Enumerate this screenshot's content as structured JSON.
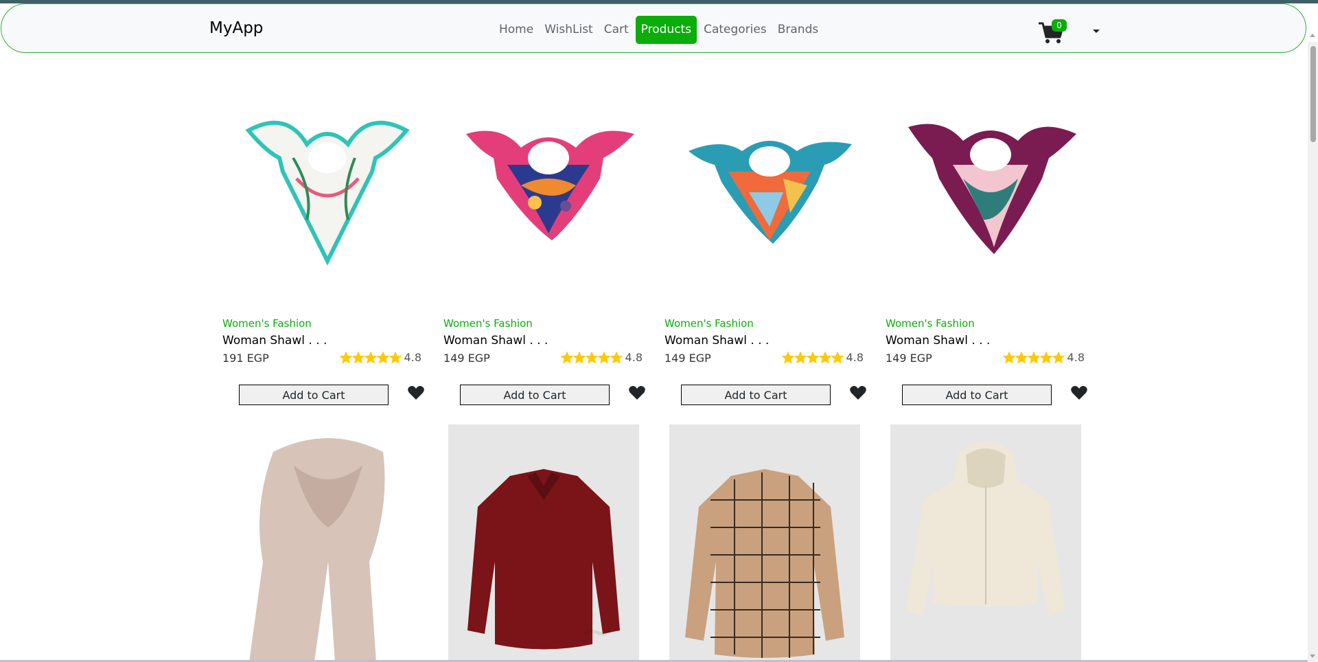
{
  "nav": {
    "brand": "MyApp",
    "links": [
      "Home",
      "WishList",
      "Cart",
      "Products",
      "Categories",
      "Brands"
    ],
    "active": "Products",
    "cart_count": "0",
    "accent": "#0aad0a"
  },
  "products": [
    {
      "category": "Women's Fashion",
      "title": "Woman Shawl . . .",
      "price": "191 EGP",
      "rating": "4.8",
      "rating_value": 4.8,
      "button": "Add to Cart",
      "image": "scarf-white-floral"
    },
    {
      "category": "Women's Fashion",
      "title": "Woman Shawl . . .",
      "price": "149 EGP",
      "rating": "4.8",
      "rating_value": 4.8,
      "button": "Add to Cart",
      "image": "scarf-pink-blue"
    },
    {
      "category": "Women's Fashion",
      "title": "Woman Shawl . . .",
      "price": "149 EGP",
      "rating": "4.8",
      "rating_value": 4.8,
      "button": "Add to Cart",
      "image": "scarf-orange-teal"
    },
    {
      "category": "Women's Fashion",
      "title": "Woman Shawl . . .",
      "price": "149 EGP",
      "rating": "4.8",
      "rating_value": 4.8,
      "button": "Add to Cart",
      "image": "scarf-maroon-pink"
    }
  ],
  "products_row2": [
    {
      "image": "scarf-beige"
    },
    {
      "image": "shirt-maroon"
    },
    {
      "image": "shirt-plaid-brown"
    },
    {
      "image": "hoodie-cream"
    }
  ]
}
